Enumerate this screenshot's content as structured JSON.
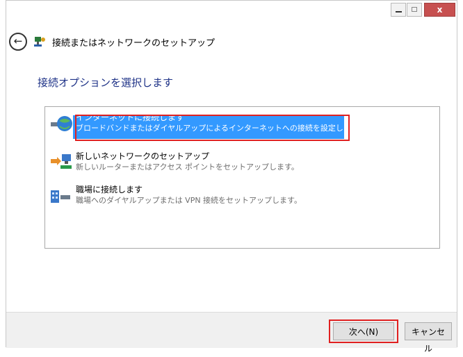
{
  "window": {
    "close_glyph": "x",
    "title": "接続またはネットワークのセットアップ"
  },
  "instruction": "接続オプションを選択します",
  "options": [
    {
      "title": "インターネットに接続します",
      "description": "ブロードバンドまたはダイヤルアップによるインターネットへの接続を設定します。",
      "icon": "internet-globe-icon",
      "selected": true
    },
    {
      "title": "新しいネットワークのセットアップ",
      "description": "新しいルーターまたはアクセス ポイントをセットアップします。",
      "icon": "new-network-icon",
      "selected": false
    },
    {
      "title": "職場に接続します",
      "description": "職場へのダイヤルアップまたは VPN 接続をセットアップします。",
      "icon": "workplace-connection-icon",
      "selected": false
    }
  ],
  "buttons": {
    "next": "次へ(N)",
    "cancel": "キャンセル"
  },
  "colors": {
    "selection": "#3399ff",
    "highlight_outline": "#e02020",
    "instruction_text": "#1e3287",
    "close_button": "#c75050"
  }
}
